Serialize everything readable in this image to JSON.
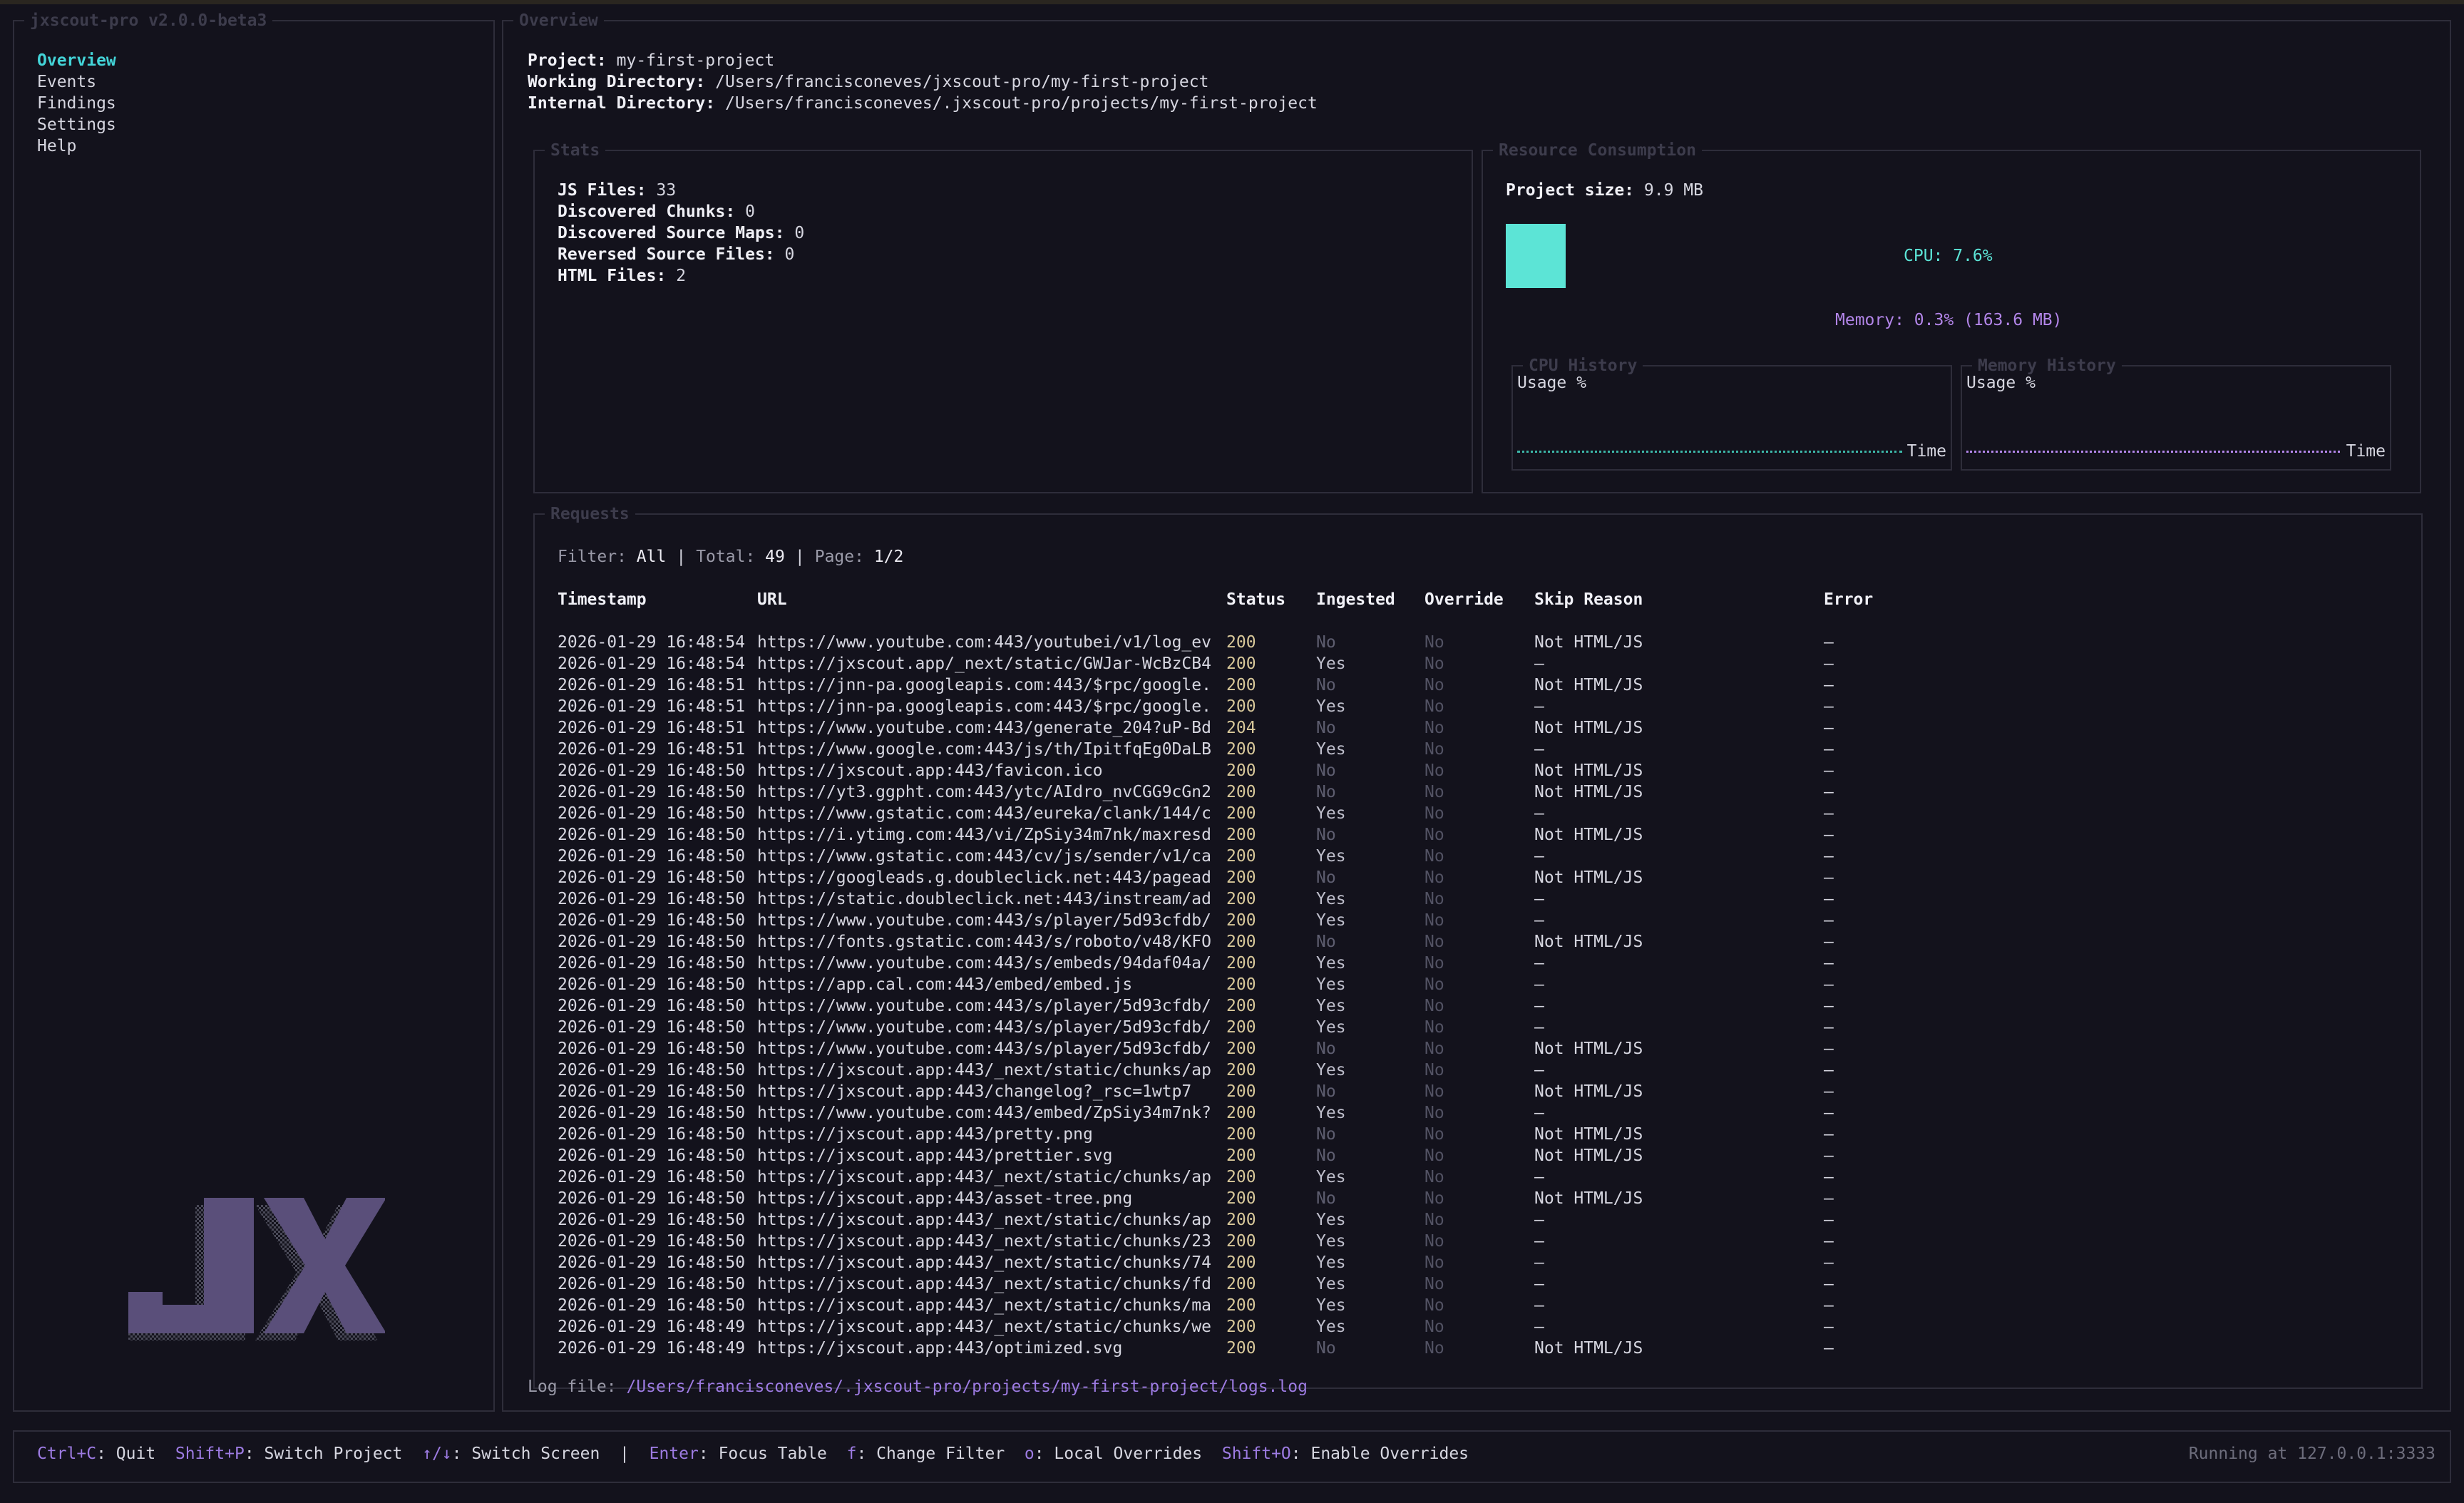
{
  "app_title": "jxscout-pro v2.0.0-beta3",
  "sidebar": {
    "items": [
      "Overview",
      "Events",
      "Findings",
      "Settings",
      "Help"
    ],
    "active": "Overview",
    "logo_text": "JX"
  },
  "overview": {
    "title": "Overview",
    "project_label": "Project:",
    "project": "my-first-project",
    "workdir_label": "Working Directory:",
    "workdir": "/Users/francisconeves/jxscout-pro/my-first-project",
    "internal_label": "Internal Directory:",
    "internal": "/Users/francisconeves/.jxscout-pro/projects/my-first-project"
  },
  "stats": {
    "title": "Stats",
    "items": [
      {
        "label": "JS Files:",
        "value": "33"
      },
      {
        "label": "Discovered Chunks:",
        "value": "0"
      },
      {
        "label": "Discovered Source Maps:",
        "value": "0"
      },
      {
        "label": "Reversed Source Files:",
        "value": "0"
      },
      {
        "label": "HTML Files:",
        "value": "2"
      }
    ]
  },
  "resources": {
    "title": "Resource Consumption",
    "project_size_label": "Project size:",
    "project_size": "9.9 MB",
    "cpu": "CPU: 7.6%",
    "memory": "Memory: 0.3% (163.6 MB)",
    "cpu_history": {
      "title": "CPU History",
      "ylabel": "Usage %",
      "xlabel": "Time"
    },
    "memory_history": {
      "title": "Memory History",
      "ylabel": "Usage %",
      "xlabel": "Time"
    },
    "colors": {
      "cpu": "#5ce4d6",
      "memory": "#b285e8"
    }
  },
  "requests": {
    "title": "Requests",
    "filter_label": "Filter:",
    "filter": "All",
    "total_label": "Total:",
    "total": "49",
    "page_label": "Page:",
    "page": "1/2",
    "columns": [
      "Timestamp",
      "URL",
      "Status",
      "Ingested",
      "Override",
      "Skip Reason",
      "Error"
    ],
    "rows": [
      [
        "2026-01-29 16:48:54",
        "https://www.youtube.com:443/youtubei/v1/log_ev",
        "200",
        "No",
        "No",
        "Not HTML/JS",
        "—"
      ],
      [
        "2026-01-29 16:48:54",
        "https://jxscout.app/_next/static/GWJar-WcBzCB4",
        "200",
        "Yes",
        "No",
        "—",
        "—"
      ],
      [
        "2026-01-29 16:48:51",
        "https://jnn-pa.googleapis.com:443/$rpc/google.",
        "200",
        "No",
        "No",
        "Not HTML/JS",
        "—"
      ],
      [
        "2026-01-29 16:48:51",
        "https://jnn-pa.googleapis.com:443/$rpc/google.",
        "200",
        "Yes",
        "No",
        "—",
        "—"
      ],
      [
        "2026-01-29 16:48:51",
        "https://www.youtube.com:443/generate_204?uP-Bd",
        "204",
        "No",
        "No",
        "Not HTML/JS",
        "—"
      ],
      [
        "2026-01-29 16:48:51",
        "https://www.google.com:443/js/th/IpitfqEg0DaLB",
        "200",
        "Yes",
        "No",
        "—",
        "—"
      ],
      [
        "2026-01-29 16:48:50",
        "https://jxscout.app:443/favicon.ico",
        "200",
        "No",
        "No",
        "Not HTML/JS",
        "—"
      ],
      [
        "2026-01-29 16:48:50",
        "https://yt3.ggpht.com:443/ytc/AIdro_nvCGG9cGn2",
        "200",
        "No",
        "No",
        "Not HTML/JS",
        "—"
      ],
      [
        "2026-01-29 16:48:50",
        "https://www.gstatic.com:443/eureka/clank/144/c",
        "200",
        "Yes",
        "No",
        "—",
        "—"
      ],
      [
        "2026-01-29 16:48:50",
        "https://i.ytimg.com:443/vi/ZpSiy34m7nk/maxresd",
        "200",
        "No",
        "No",
        "Not HTML/JS",
        "—"
      ],
      [
        "2026-01-29 16:48:50",
        "https://www.gstatic.com:443/cv/js/sender/v1/ca",
        "200",
        "Yes",
        "No",
        "—",
        "—"
      ],
      [
        "2026-01-29 16:48:50",
        "https://googleads.g.doubleclick.net:443/pagead",
        "200",
        "No",
        "No",
        "Not HTML/JS",
        "—"
      ],
      [
        "2026-01-29 16:48:50",
        "https://static.doubleclick.net:443/instream/ad",
        "200",
        "Yes",
        "No",
        "—",
        "—"
      ],
      [
        "2026-01-29 16:48:50",
        "https://www.youtube.com:443/s/player/5d93cfdb/",
        "200",
        "Yes",
        "No",
        "—",
        "—"
      ],
      [
        "2026-01-29 16:48:50",
        "https://fonts.gstatic.com:443/s/roboto/v48/KFO",
        "200",
        "No",
        "No",
        "Not HTML/JS",
        "—"
      ],
      [
        "2026-01-29 16:48:50",
        "https://www.youtube.com:443/s/embeds/94daf04a/",
        "200",
        "Yes",
        "No",
        "—",
        "—"
      ],
      [
        "2026-01-29 16:48:50",
        "https://app.cal.com:443/embed/embed.js",
        "200",
        "Yes",
        "No",
        "—",
        "—"
      ],
      [
        "2026-01-29 16:48:50",
        "https://www.youtube.com:443/s/player/5d93cfdb/",
        "200",
        "Yes",
        "No",
        "—",
        "—"
      ],
      [
        "2026-01-29 16:48:50",
        "https://www.youtube.com:443/s/player/5d93cfdb/",
        "200",
        "Yes",
        "No",
        "—",
        "—"
      ],
      [
        "2026-01-29 16:48:50",
        "https://www.youtube.com:443/s/player/5d93cfdb/",
        "200",
        "No",
        "No",
        "Not HTML/JS",
        "—"
      ],
      [
        "2026-01-29 16:48:50",
        "https://jxscout.app:443/_next/static/chunks/ap",
        "200",
        "Yes",
        "No",
        "—",
        "—"
      ],
      [
        "2026-01-29 16:48:50",
        "https://jxscout.app:443/changelog?_rsc=1wtp7",
        "200",
        "No",
        "No",
        "Not HTML/JS",
        "—"
      ],
      [
        "2026-01-29 16:48:50",
        "https://www.youtube.com:443/embed/ZpSiy34m7nk?",
        "200",
        "Yes",
        "No",
        "—",
        "—"
      ],
      [
        "2026-01-29 16:48:50",
        "https://jxscout.app:443/pretty.png",
        "200",
        "No",
        "No",
        "Not HTML/JS",
        "—"
      ],
      [
        "2026-01-29 16:48:50",
        "https://jxscout.app:443/prettier.svg",
        "200",
        "No",
        "No",
        "Not HTML/JS",
        "—"
      ],
      [
        "2026-01-29 16:48:50",
        "https://jxscout.app:443/_next/static/chunks/ap",
        "200",
        "Yes",
        "No",
        "—",
        "—"
      ],
      [
        "2026-01-29 16:48:50",
        "https://jxscout.app:443/asset-tree.png",
        "200",
        "No",
        "No",
        "Not HTML/JS",
        "—"
      ],
      [
        "2026-01-29 16:48:50",
        "https://jxscout.app:443/_next/static/chunks/ap",
        "200",
        "Yes",
        "No",
        "—",
        "—"
      ],
      [
        "2026-01-29 16:48:50",
        "https://jxscout.app:443/_next/static/chunks/23",
        "200",
        "Yes",
        "No",
        "—",
        "—"
      ],
      [
        "2026-01-29 16:48:50",
        "https://jxscout.app:443/_next/static/chunks/74",
        "200",
        "Yes",
        "No",
        "—",
        "—"
      ],
      [
        "2026-01-29 16:48:50",
        "https://jxscout.app:443/_next/static/chunks/fd",
        "200",
        "Yes",
        "No",
        "—",
        "—"
      ],
      [
        "2026-01-29 16:48:50",
        "https://jxscout.app:443/_next/static/chunks/ma",
        "200",
        "Yes",
        "No",
        "—",
        "—"
      ],
      [
        "2026-01-29 16:48:49",
        "https://jxscout.app:443/_next/static/chunks/we",
        "200",
        "Yes",
        "No",
        "—",
        "—"
      ],
      [
        "2026-01-29 16:48:49",
        "https://jxscout.app:443/optimized.svg",
        "200",
        "No",
        "No",
        "Not HTML/JS",
        "—"
      ]
    ]
  },
  "log": {
    "label": "Log file:",
    "path": "/Users/francisconeves/.jxscout-pro/projects/my-first-project/logs.log"
  },
  "footer": {
    "items": [
      {
        "key": "Ctrl+C",
        "text": ": Quit"
      },
      {
        "key": "Shift+P",
        "text": ": Switch Project"
      },
      {
        "key": "↑/↓",
        "text": ": Switch Screen"
      },
      {
        "key": "Enter",
        "text": ": Focus Table",
        "sep_before": true
      },
      {
        "key": "f",
        "text": ": Change Filter"
      },
      {
        "key": "o",
        "text": ": Local Overrides"
      },
      {
        "key": "Shift+O",
        "text": ": Enable Overrides"
      }
    ],
    "separator": "|",
    "status": "Running at 127.0.0.1:3333"
  }
}
